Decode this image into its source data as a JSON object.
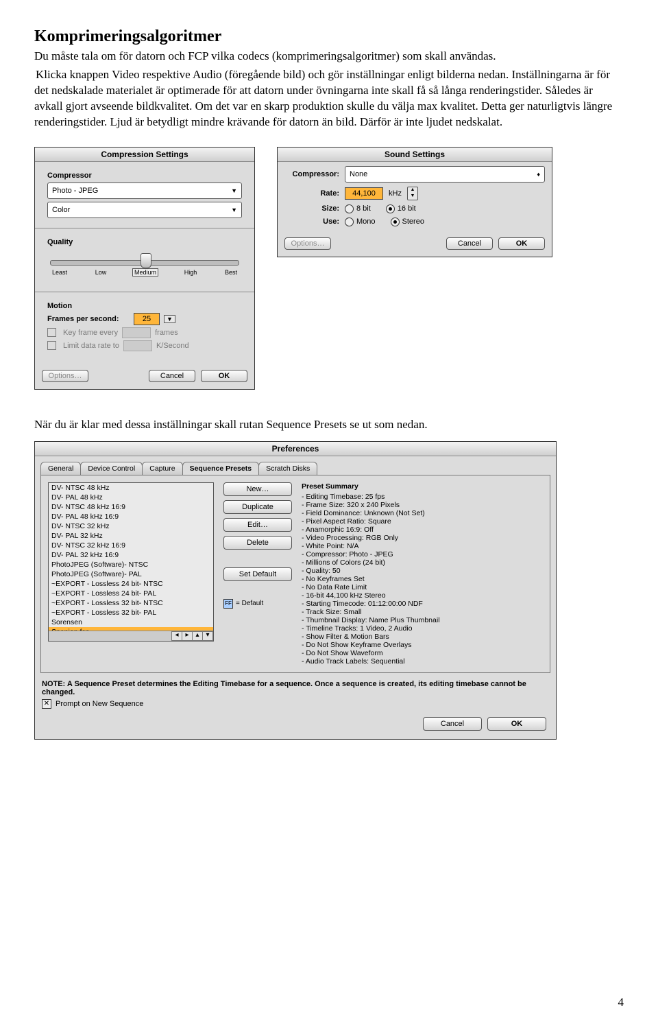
{
  "heading": "Komprimeringsalgoritmer",
  "para1": "Du måste tala om för datorn och FCP vilka codecs (komprimeringsalgoritmer) som skall användas.",
  "apple_icon": "",
  "para2": " Klicka knappen Video respektive Audio (föregående bild) och gör inställningar enligt bilderna nedan. Inställningarna är för det nedskalade materialet är optimerade för att datorn under övningarna inte skall få så långa renderingstider. Således är avkall gjort avseende bildkvalitet. Om det var en skarp produktion skulle du välja max kvalitet. Detta ger naturligtvis längre renderingstider. Ljud är betydligt mindre krävande för datorn än bild. Därför är inte ljudet nedskalat.",
  "para3": "När du är klar med dessa inställningar skall rutan Sequence Presets  se ut som nedan.",
  "comp": {
    "title": "Compression Settings",
    "group1": "Compressor",
    "codec": "Photo - JPEG",
    "depth": "Color",
    "group2": "Quality",
    "ticks": [
      "Least",
      "Low",
      "Medium",
      "High",
      "Best"
    ],
    "group3": "Motion",
    "fps_label": "Frames per second:",
    "fps": "25",
    "kfe": "Key frame every",
    "kfe_unit": "frames",
    "ldr": "Limit data rate to",
    "ldr_unit": "K/Second",
    "options": "Options…",
    "cancel": "Cancel",
    "ok": "OK"
  },
  "sound": {
    "title": "Sound Settings",
    "compressor_lab": "Compressor:",
    "compressor_val": "None",
    "rate_lab": "Rate:",
    "rate_val": "44,100",
    "rate_unit": "kHz",
    "size_lab": "Size:",
    "size_a": "8 bit",
    "size_b": "16 bit",
    "use_lab": "Use:",
    "use_a": "Mono",
    "use_b": "Stereo",
    "options": "Options…",
    "cancel": "Cancel",
    "ok": "OK"
  },
  "pref": {
    "title": "Preferences",
    "tabs": [
      "General",
      "Device Control",
      "Capture",
      "Sequence Presets",
      "Scratch Disks"
    ],
    "active_tab": 3,
    "new": "New…",
    "dup": "Duplicate",
    "edit": "Edit…",
    "del": "Delete",
    "setdef": "Set Default",
    "deflabel": " = Default",
    "deficon": "FF",
    "list": [
      "DV- NTSC 48 kHz",
      "DV- PAL   48 kHz",
      "DV- NTSC 48 kHz 16:9",
      "DV- PAL  48 kHz 16:9",
      "DV- NTSC 32 kHz",
      "DV- PAL   32 kHz",
      "DV- NTSC 32 kHz 16:9",
      "DV- PAL  32 kHz 16:9",
      "PhotoJPEG (Software)- NTSC",
      "PhotoJPEG (Software)- PAL",
      "~EXPORT - Lossless 24 bit- NTSC",
      "~EXPORT - Lossless 24 bit- PAL",
      "~EXPORT - Lossless 32 bit- NTSC",
      "~EXPORT - Lossless 32 bit- PAL",
      "Sorensen",
      "Spanien.fcp"
    ],
    "selected": 15,
    "summary_hd": "Preset Summary",
    "summary": [
      "Editing Timebase: 25 fps",
      "Frame Size: 320 x 240 Pixels",
      "Field Dominance: Unknown (Not Set)",
      "Pixel Aspect Ratio: Square",
      "Anamorphic 16:9: Off",
      "Video Processing: RGB Only",
      "White Point: N/A",
      "Compressor: Photo - JPEG",
      "Millions of Colors (24 bit)",
      "Quality: 50",
      "No Keyframes Set",
      "No Data Rate Limit",
      "16-bit 44,100 kHz Stereo",
      "Starting Timecode: 01:12:00:00 NDF",
      "Track Size: Small",
      "Thumbnail Display: Name Plus Thumbnail",
      "Timeline Tracks: 1 Video, 2 Audio",
      "Show Filter & Motion Bars",
      "Do Not Show Keyframe Overlays",
      "Do Not Show Waveform",
      "Audio Track Labels: Sequential"
    ],
    "note": "NOTE: A Sequence Preset determines the Editing Timebase for a sequence. Once a sequence is created, its editing timebase cannot be changed.",
    "prompt": "Prompt on New Sequence",
    "cancel": "Cancel",
    "ok": "OK"
  },
  "page": "4"
}
